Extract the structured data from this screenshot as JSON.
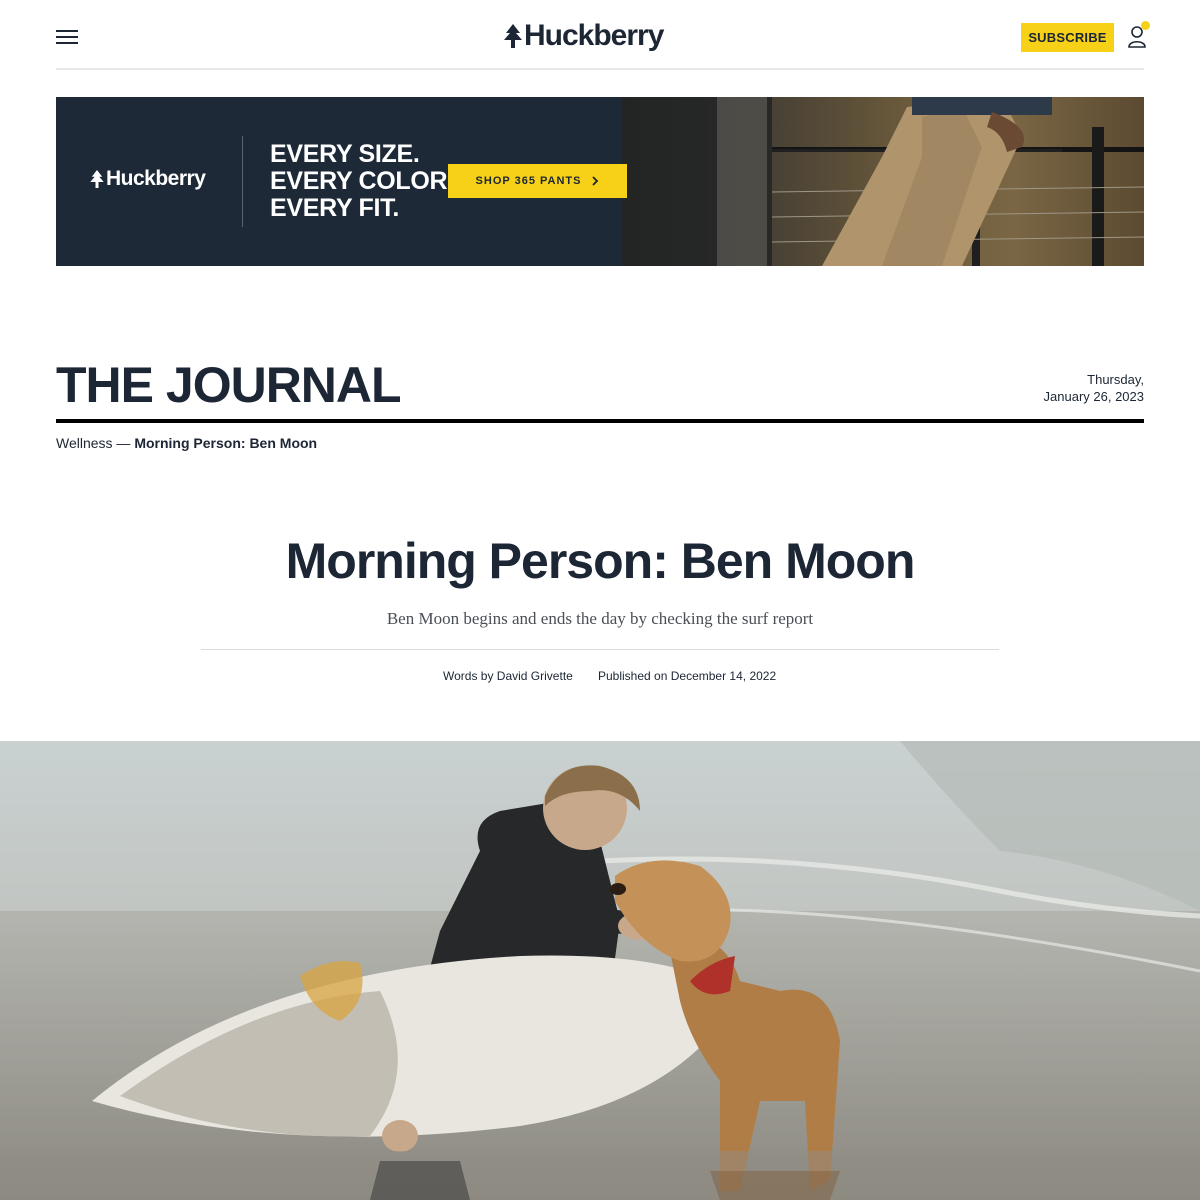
{
  "header": {
    "brand": "Huckberry",
    "subscribe_label": "SUBSCRIBE"
  },
  "banner": {
    "brand": "Huckberry",
    "tagline": [
      "EVERY SIZE.",
      "EVERY COLOR.",
      "EVERY FIT."
    ],
    "cta_label": "SHOP 365 PANTS"
  },
  "journal": {
    "title": "THE JOURNAL",
    "date_line1": "Thursday,",
    "date_line2": "January 26, 2023"
  },
  "breadcrumb": {
    "category": "Wellness",
    "separator": " — ",
    "current": "Morning Person: Ben Moon"
  },
  "article": {
    "title": "Morning Person: Ben Moon",
    "dek": "Ben Moon begins and ends the day by checking the surf report",
    "byline_prefix": "Words by ",
    "author": "David Grivette",
    "published_prefix": "Published on ",
    "published_date": "December 14, 2022"
  },
  "colors": {
    "accent_yellow": "#f7d117",
    "navy": "#1c2634",
    "banner_navy": "#1d2937"
  },
  "icons": {
    "menu": "hamburger-menu-icon",
    "logo": "tree-logo-icon",
    "account": "user-account-icon",
    "cta_arrow": "chevron-right-icon"
  }
}
